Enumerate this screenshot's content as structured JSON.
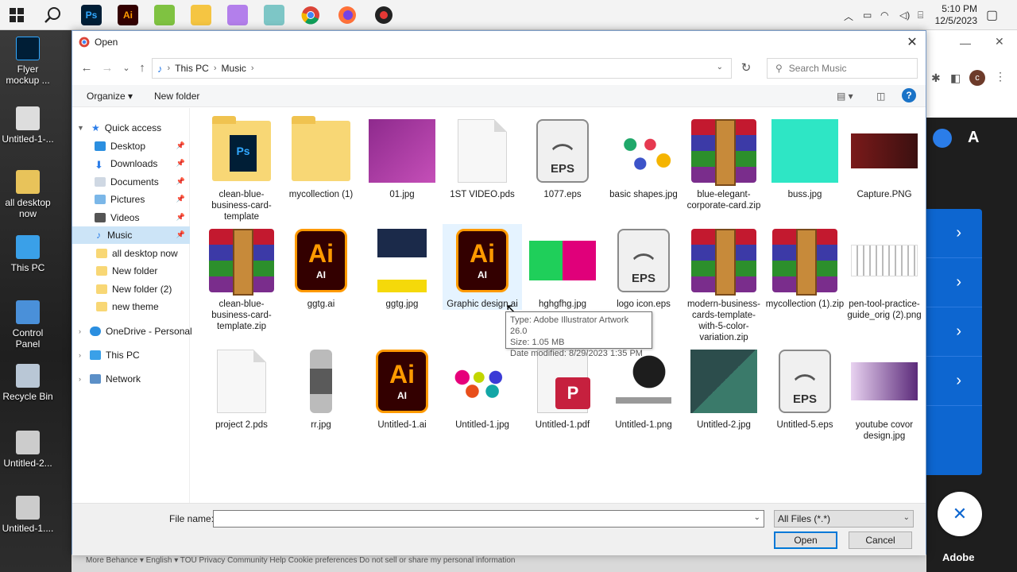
{
  "taskbar": {
    "apps": [
      {
        "label": "",
        "icon": "windows-start-icon"
      },
      {
        "label": "",
        "icon": "search-icon"
      },
      {
        "label": "Ps",
        "icon": "photoshop-icon",
        "color": "#31a8ff",
        "bg": "#001e36"
      },
      {
        "label": "Ai",
        "icon": "illustrator-icon",
        "color": "#ff9a00",
        "bg": "#330000"
      },
      {
        "label": "",
        "icon": "notepad-icon"
      },
      {
        "label": "",
        "icon": "file-explorer-icon"
      },
      {
        "label": "",
        "icon": "feather-pen-icon"
      },
      {
        "label": "",
        "icon": "files-app-icon"
      },
      {
        "label": "",
        "icon": "chrome-icon"
      },
      {
        "label": "",
        "icon": "firefox-icon"
      },
      {
        "label": "",
        "icon": "obs-icon"
      }
    ],
    "time": "5:10 PM",
    "date": "12/5/2023"
  },
  "desktop": {
    "icons": [
      {
        "label": "Flyer mockup ...",
        "icon": "photoshop-file-icon"
      },
      {
        "label": "Untitled-1-...",
        "icon": "image-file-icon"
      },
      {
        "label": "all desktop now",
        "icon": "zip-folder-icon"
      },
      {
        "label": "This PC",
        "icon": "computer-icon"
      },
      {
        "label": "Control Panel",
        "icon": "control-panel-icon"
      },
      {
        "label": "Recycle Bin",
        "icon": "recycle-bin-icon"
      },
      {
        "label": "Untitled-2...",
        "icon": "image-file-icon"
      },
      {
        "label": "Untitled-1....",
        "icon": "image-file-icon"
      }
    ]
  },
  "dialog": {
    "title": "Open",
    "breadcrumb": [
      "This PC",
      "Music"
    ],
    "search_placeholder": "Search Music",
    "toolbar": {
      "organize": "Organize",
      "new_folder": "New folder"
    },
    "nav": {
      "quick_access": "Quick access",
      "pinned": [
        "Desktop",
        "Downloads",
        "Documents",
        "Pictures",
        "Videos",
        "Music"
      ],
      "folders": [
        "all desktop now",
        "New folder",
        "New folder (2)",
        "new theme"
      ],
      "onedrive": "OneDrive - Personal",
      "this_pc": "This PC",
      "network": "Network"
    },
    "files": [
      {
        "name": "clean-blue-business-card-template",
        "kind": "psd-folder"
      },
      {
        "name": "mycollection (1)",
        "kind": "folder"
      },
      {
        "name": "01.jpg",
        "kind": "img-purple"
      },
      {
        "name": "1ST VIDEO.pds",
        "kind": "doc"
      },
      {
        "name": "1077.eps",
        "kind": "eps"
      },
      {
        "name": "basic shapes.jpg",
        "kind": "img-shapes"
      },
      {
        "name": "blue-elegant-corporate-card.zip",
        "kind": "zip"
      },
      {
        "name": "buss.jpg",
        "kind": "img-teal"
      },
      {
        "name": "Capture.PNG",
        "kind": "img-capture"
      },
      {
        "name": "clean-blue-business-card-template.zip",
        "kind": "zip"
      },
      {
        "name": "ggtg.ai",
        "kind": "ai"
      },
      {
        "name": "ggtg.jpg",
        "kind": "img-marketing"
      },
      {
        "name": "Graphic design.ai",
        "kind": "ai"
      },
      {
        "name": "hghgfhg.jpg",
        "kind": "img-greenpink"
      },
      {
        "name": "logo icon.eps",
        "kind": "eps"
      },
      {
        "name": "modern-business-cards-template-with-5-color-variation.zip",
        "kind": "zip"
      },
      {
        "name": "mycollection (1).zip",
        "kind": "zip"
      },
      {
        "name": "pen-tool-practice-guide_orig (2).png",
        "kind": "img-pentool"
      },
      {
        "name": "project 2.pds",
        "kind": "doc"
      },
      {
        "name": "rr.jpg",
        "kind": "img-watch"
      },
      {
        "name": "Untitled-1.ai",
        "kind": "ai"
      },
      {
        "name": "Untitled-1.jpg",
        "kind": "img-shapes2"
      },
      {
        "name": "Untitled-1.pdf",
        "kind": "pdf"
      },
      {
        "name": "Untitled-1.png",
        "kind": "img-geo"
      },
      {
        "name": "Untitled-2.jpg",
        "kind": "img-card"
      },
      {
        "name": "Untitled-5.eps",
        "kind": "eps"
      },
      {
        "name": "youtube covor design.jpg",
        "kind": "img-youtube"
      }
    ],
    "tooltip": {
      "type": "Type: Adobe Illustrator Artwork 26.0",
      "size": "Size: 1.05 MB",
      "modified": "Date modified: 8/29/2023 1:35 PM"
    },
    "file_name_label": "File name:",
    "file_name_value": "",
    "file_type": "All Files (*.*)",
    "open_label": "Open",
    "cancel_label": "Cancel"
  },
  "browser": {
    "adobe": "Adobe",
    "footer": "More Behance ▾      English ▾      TOU    Privacy    Community    Help    Cookie preferences    Do not sell or share my personal information"
  },
  "colors": {
    "accent": "#0078d7",
    "selection": "#cce4f7",
    "hover": "#e5f3ff"
  }
}
